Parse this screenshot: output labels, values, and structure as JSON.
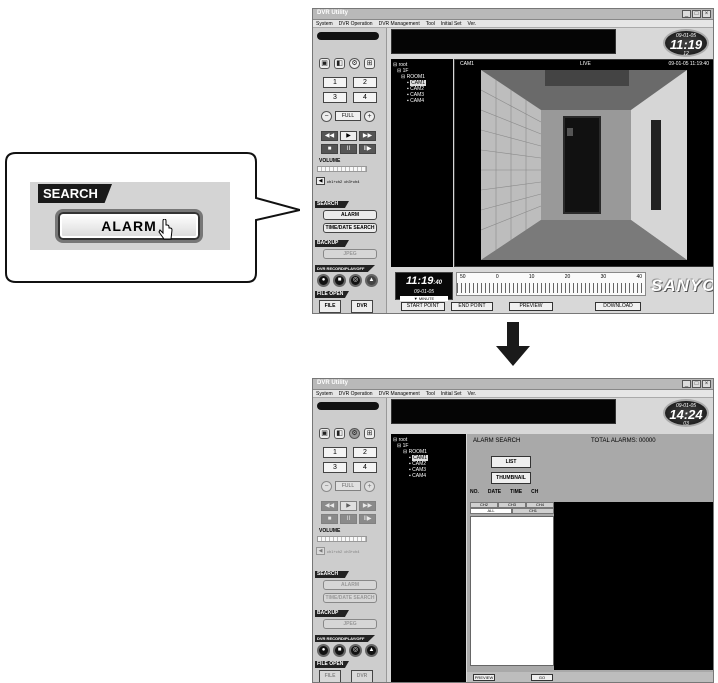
{
  "window": {
    "title": "DVR Utility",
    "controls": [
      "_",
      "□",
      "×"
    ],
    "menu": [
      "System",
      "DVR Operation",
      "DVR Management",
      "Tool",
      "Initial Set",
      "Ver."
    ]
  },
  "panel": {
    "top_icons": [
      "camera-icon",
      "multiscreen-icon",
      "settings-icon",
      "grid-icon"
    ],
    "nums": [
      "1",
      "2",
      "3",
      "4"
    ],
    "zoom_minus": "−",
    "full_label": "FULL",
    "zoom_plus": "+",
    "playback": [
      "◀◀",
      "▶",
      "▶▶",
      "■",
      "II",
      "II▶"
    ],
    "volume_label": "VOLUME",
    "ch_left": "◀",
    "ch1_label": "ch1+ch2",
    "ch3_label": "ch3+ch4",
    "search_tag": "SEARCH",
    "alarm_label": "ALARM",
    "time_search_label": "TIME/DATE SEARCH",
    "backup_tag": "BACKUP",
    "jpeg_label": "JPEG",
    "rec_tag": "DVR RECORD/PLAY/OFF",
    "rec_icons": [
      "●",
      "■",
      "◎",
      "▲"
    ],
    "file_tag": "FILE OPEN",
    "file_label": "FILE",
    "dvr_label": "DVR"
  },
  "screen1": {
    "clock": {
      "date": "09-01-05",
      "time": "11:19",
      "sec": "12"
    },
    "tree": [
      "root",
      "1F",
      "ROOM1",
      "CAM1",
      "CAM2",
      "CAM3",
      "CAM4"
    ],
    "video": {
      "cam": "CAM1",
      "mode": "LIVE",
      "timestamp": "09-01-05 11:19:40"
    },
    "timebox": {
      "time": "11:19",
      "sec": ":40",
      "date": "09-01-05",
      "unit": "▼ MINUTE"
    },
    "timeline_ticks": [
      "50",
      "0",
      "10",
      "20",
      "30",
      "40"
    ],
    "brand": "SANYO",
    "buttons": {
      "start": "START POINT",
      "end": "END POINT",
      "preview": "PREVIEW",
      "download": "DOWNLOAD"
    }
  },
  "screen2": {
    "clock": {
      "date": "09-01-05",
      "time": "14:24",
      "sec": "03"
    },
    "tree": [
      "root",
      "1F",
      "ROOM1",
      "CAM1",
      "CAM2",
      "CAM3",
      "CAM4"
    ],
    "alarm_title": "ALARM SEARCH",
    "total_alarms": "TOTAL ALARMS: 00000",
    "list_label": "LIST",
    "thumbnail_label": "THUMBNAIL",
    "cols": [
      "NO.",
      "DATE",
      "TIME",
      "CH"
    ],
    "ch_tabs": [
      "CH2",
      "CH3",
      "CH4"
    ],
    "ch_tabs2": [
      "ALL",
      "CH1"
    ],
    "preview_label": "PREVIEW",
    "go_label": "GO"
  },
  "callout": {
    "heading": "SEARCH",
    "button": "ALARM"
  },
  "colors": {
    "arrow": "#1a1a1a",
    "panel": "#d8d8d8",
    "screen": "#000000"
  }
}
